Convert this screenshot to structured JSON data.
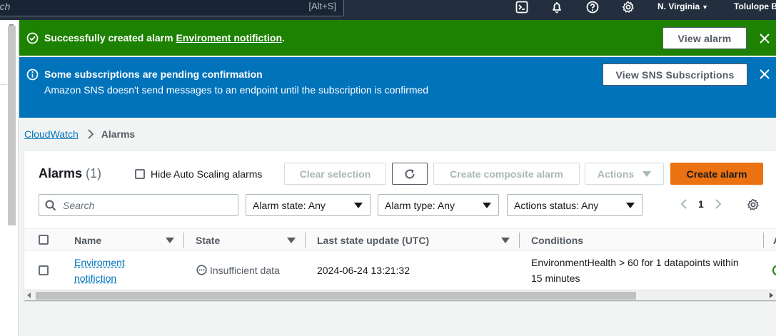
{
  "topnav": {
    "search_placeholder": "rch",
    "search_shortcut": "[Alt+S]",
    "icons": [
      "cloudshell-icon",
      "notifications-icon",
      "help-icon",
      "settings-icon"
    ],
    "region": "N. Virginia",
    "user": "Tolulope B"
  },
  "flash_success": {
    "prefix": "Successfully created alarm ",
    "alarm_name": "Enviroment notifiction",
    "suffix": ".",
    "button": "View alarm",
    "color": "#1d8102"
  },
  "flash_info": {
    "title": "Some subscriptions are pending confirmation",
    "message": "Amazon SNS doesn't send messages to an endpoint until the subscription is confirmed",
    "button": "View SNS Subscriptions",
    "color": "#0073bb"
  },
  "breadcrumb": {
    "root": "CloudWatch",
    "current": "Alarms"
  },
  "alarms_panel": {
    "title": "Alarms",
    "count": "(1)",
    "hide_autoscaling_label": "Hide Auto Scaling alarms",
    "buttons": {
      "clear_selection": "Clear selection",
      "create_composite": "Create composite alarm",
      "actions": "Actions",
      "create_alarm": "Create alarm"
    },
    "search_placeholder": "Search",
    "filters": {
      "alarm_state": "Alarm state: Any",
      "alarm_type": "Alarm type: Any",
      "actions_status": "Actions status: Any"
    },
    "page": "1",
    "columns": [
      "Name",
      "State",
      "Last state update (UTC)",
      "Conditions",
      "A"
    ],
    "rows": [
      {
        "name_line1": "Enviroment",
        "name_line2": "notifiction",
        "state": "Insufficient data",
        "last_update": "2024-06-24 13:21:32",
        "conditions_line1": "EnvironmentHealth > 60 for 1 datapoints within",
        "conditions_line2": "15 minutes"
      }
    ],
    "accent_color": "#ec7211"
  }
}
